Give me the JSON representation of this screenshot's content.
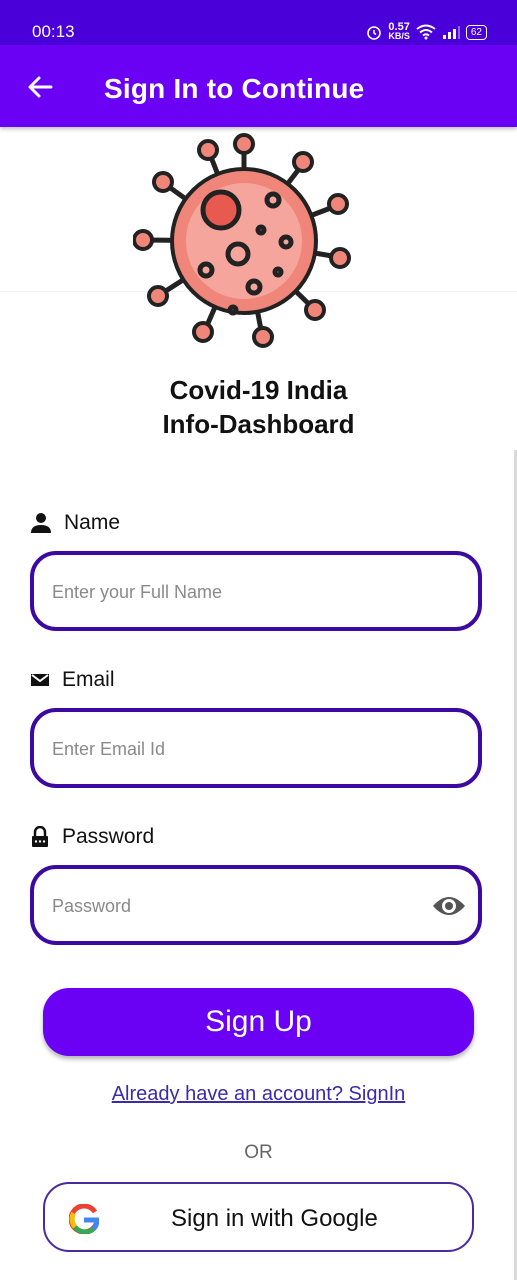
{
  "status": {
    "time": "00:13",
    "speed_value": "0.57",
    "speed_unit": "KB/S",
    "battery": "62"
  },
  "app_bar": {
    "title": "Sign In to Continue"
  },
  "heading": {
    "line1": "Covid-19 India",
    "line2": "Info-Dashboard"
  },
  "form": {
    "name": {
      "label": "Name",
      "placeholder": "Enter your Full Name",
      "icon": "person-icon"
    },
    "email": {
      "label": "Email",
      "placeholder": "Enter Email Id",
      "icon": "mail-icon"
    },
    "password": {
      "label": "Password",
      "placeholder": "Password",
      "icon": "lock-icon"
    }
  },
  "actions": {
    "signup_label": "Sign Up",
    "signin_link": "Already have an account? SignIn",
    "or_text": "OR",
    "google_label": "Sign in with Google"
  },
  "colors": {
    "status_bar": "#4a00d9",
    "app_bar": "#6a00f4",
    "field_border": "#3c0aa0",
    "virus": "#f0857a"
  }
}
